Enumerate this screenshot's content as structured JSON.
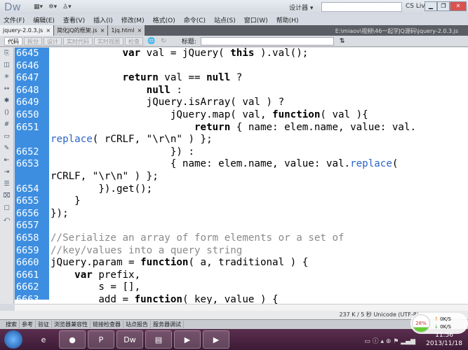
{
  "app": {
    "logo": "Dw",
    "workspace": "设计器 ▾",
    "cs_live": "CS Live",
    "search_placeholder": ""
  },
  "menu": [
    "文件(F)",
    "编辑(E)",
    "查看(V)",
    "插入(I)",
    "修改(M)",
    "格式(O)",
    "命令(C)",
    "站点(S)",
    "窗口(W)",
    "帮助(H)"
  ],
  "doc_tabs": [
    {
      "label": "jquery-2.0.3.js",
      "active": true
    },
    {
      "label": "简化JQ的框架.js",
      "active": false
    },
    {
      "label": "1jq.html",
      "active": false
    }
  ],
  "file_path": "E:\\miaov\\视频\\46一起学JQ源码\\jquery-2.0.3.js",
  "toolbar": {
    "code": "代码",
    "split": "拆分",
    "design": "设计",
    "live_code": "实时代码",
    "live_view": "实时视图",
    "inspect": "检查",
    "title_label": "标题:",
    "title_value": ""
  },
  "code_rows": [
    {
      "n": "6645",
      "t": [
        [
          "",
          "            "
        ],
        [
          "k",
          "var"
        ],
        [
          "",
          " val = jQuery( "
        ],
        [
          "k",
          "this"
        ],
        [
          "",
          " ).val();"
        ]
      ]
    },
    {
      "n": "6646",
      "t": []
    },
    {
      "n": "6647",
      "t": [
        [
          "",
          "            "
        ],
        [
          "k",
          "return"
        ],
        [
          "",
          " val == "
        ],
        [
          "k",
          "null"
        ],
        [
          "",
          " ?"
        ]
      ]
    },
    {
      "n": "6648",
      "t": [
        [
          "",
          "                "
        ],
        [
          "k",
          "null"
        ],
        [
          "",
          " :"
        ]
      ]
    },
    {
      "n": "6649",
      "t": [
        [
          "",
          "                jQuery.isArray( val ) ?"
        ]
      ]
    },
    {
      "n": "6650",
      "t": [
        [
          "",
          "                    jQuery.map( val, "
        ],
        [
          "k",
          "function"
        ],
        [
          "",
          "( val ){"
        ]
      ]
    },
    {
      "n": "6651",
      "t": [
        [
          "",
          "                        "
        ],
        [
          "k",
          "return"
        ],
        [
          "",
          " { name: elem.name, value: val."
        ]
      ]
    },
    {
      "n": "",
      "t": [
        [
          "m",
          "replace"
        ],
        [
          "",
          "( rCRLF, \"\\r\\n\" ) };"
        ]
      ]
    },
    {
      "n": "6652",
      "t": [
        [
          "",
          "                    }) :"
        ]
      ]
    },
    {
      "n": "6653",
      "t": [
        [
          "",
          "                    { name: elem.name, value: val."
        ],
        [
          "m",
          "replace"
        ],
        [
          "",
          "("
        ]
      ]
    },
    {
      "n": "",
      "t": [
        [
          "",
          "rCRLF, \"\\r\\n\" ) };"
        ]
      ]
    },
    {
      "n": "6654",
      "t": [
        [
          "",
          "        }).get();"
        ]
      ]
    },
    {
      "n": "6655",
      "t": [
        [
          "",
          "    }"
        ]
      ]
    },
    {
      "n": "6656",
      "t": [
        [
          "",
          "});"
        ]
      ]
    },
    {
      "n": "6657",
      "t": []
    },
    {
      "n": "6658",
      "t": [
        [
          "c",
          "//Serialize an array of form elements or a set of"
        ]
      ]
    },
    {
      "n": "6659",
      "t": [
        [
          "c",
          "//key/values into a query string"
        ]
      ]
    },
    {
      "n": "6660",
      "t": [
        [
          "",
          "jQuery.param = "
        ],
        [
          "k",
          "function"
        ],
        [
          "",
          "( a, traditional ) {"
        ]
      ]
    },
    {
      "n": "6661",
      "t": [
        [
          "",
          "    "
        ],
        [
          "k",
          "var"
        ],
        [
          "",
          " prefix,"
        ]
      ]
    },
    {
      "n": "6662",
      "t": [
        [
          "",
          "        s = [],"
        ]
      ]
    },
    {
      "n": "6663",
      "t": [
        [
          "",
          "        add = "
        ],
        [
          "k",
          "function"
        ],
        [
          "",
          "( key, value ) {"
        ]
      ]
    }
  ],
  "status": {
    "text": "237 K / 5 秒 Unicode (UTF-8)"
  },
  "panel_tabs": [
    "搜索",
    "参考",
    "验证",
    "浏览器兼容性",
    "链接检查器",
    "站点报告",
    "服务器调试"
  ],
  "network": {
    "cpu": "28%",
    "cpu_level": 0.28,
    "up": "0K/S",
    "down": "0K/S"
  },
  "clock": {
    "time": "11:56",
    "date": "2013/11/18"
  },
  "taskbar": [
    {
      "name": "ie",
      "glyph": "e"
    },
    {
      "name": "firefox",
      "glyph": "●"
    },
    {
      "name": "powerpoint",
      "glyph": "P"
    },
    {
      "name": "dreamweaver",
      "glyph": "Dw"
    },
    {
      "name": "explorer",
      "glyph": "▤"
    },
    {
      "name": "terminal",
      "glyph": "▶"
    },
    {
      "name": "terminal-2",
      "glyph": "▶"
    }
  ]
}
